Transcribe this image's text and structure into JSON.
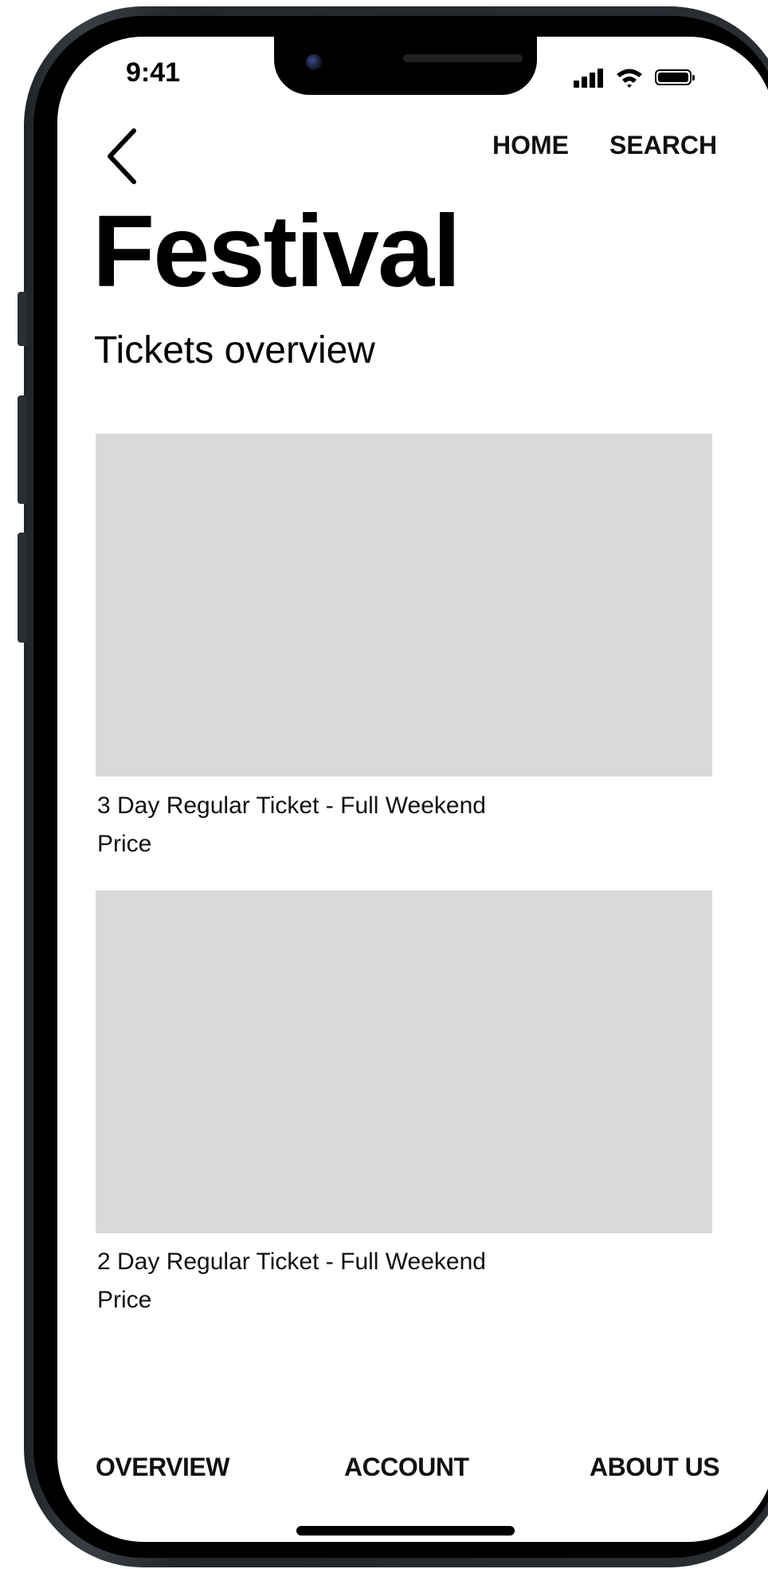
{
  "status_bar": {
    "time": "9:41"
  },
  "top_nav": {
    "home_label": "HOME",
    "search_label": "SEARCH"
  },
  "page": {
    "title": "Festival",
    "subtitle": "Tickets overview"
  },
  "tickets": [
    {
      "name": "3 Day Regular Ticket - Full Weekend",
      "price_label": "Price"
    },
    {
      "name": "2 Day Regular Ticket - Full Weekend",
      "price_label": "Price"
    }
  ],
  "bottom_nav": {
    "overview_label": "OVERVIEW",
    "account_label": "ACCOUNT",
    "about_label": "ABOUT US"
  },
  "icons": {
    "back": "chevron-left-icon",
    "signal": "cellular-signal-icon",
    "wifi": "wifi-icon",
    "battery": "battery-icon"
  },
  "colors": {
    "image_placeholder": "#d9d9d9",
    "text": "#111111",
    "background": "#ffffff"
  }
}
